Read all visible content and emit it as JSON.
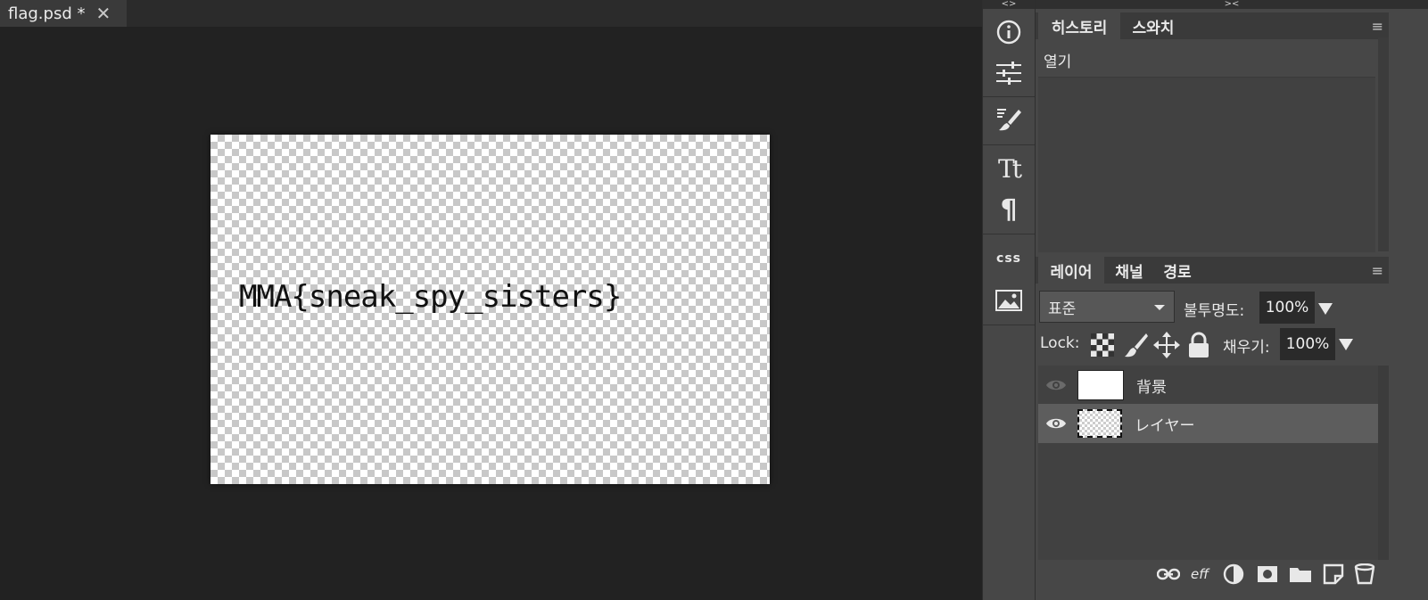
{
  "document": {
    "tab_label": "flag.psd *",
    "close_symbol": "✕",
    "canvas_text": "MMA{sneak_spy_sisters}"
  },
  "toolstrip": {
    "collapse_label": "<>",
    "tools": [
      "info-icon",
      "adjustments-icon",
      "brush-settings-icon",
      "character-icon",
      "paragraph-icon",
      "css-icon",
      "image-icon"
    ],
    "css_text": "css",
    "character_text": "Tt",
    "paragraph_text": "¶"
  },
  "panels": {
    "expand_label": "><",
    "history_group": {
      "tabs": [
        "히스토리",
        "스와치"
      ],
      "active_tab": "히스토리",
      "entries": [
        "열기"
      ]
    },
    "layers_group": {
      "tabs": [
        "레이어",
        "채널",
        "경로"
      ],
      "active_tab": "레이어",
      "blend_mode": "표준",
      "opacity_label": "불투명도:",
      "opacity_value": "100%",
      "lock_label": "Lock:",
      "fill_label": "채우기:",
      "fill_value": "100%",
      "layers": [
        {
          "name": "背景",
          "visible": true,
          "selected": false
        },
        {
          "name": "レイヤー",
          "visible": true,
          "selected": true
        }
      ],
      "footer_icons": [
        "link-icon",
        "effects-icon",
        "adjustment-layer-icon",
        "mask-icon",
        "folder-icon",
        "new-layer-icon",
        "trash-icon"
      ],
      "effects_text": "eff"
    },
    "menu_symbol": "≡"
  },
  "colors": {
    "background": "#222222",
    "panel": "#474747",
    "selected_layer": "#5d5d5d"
  }
}
